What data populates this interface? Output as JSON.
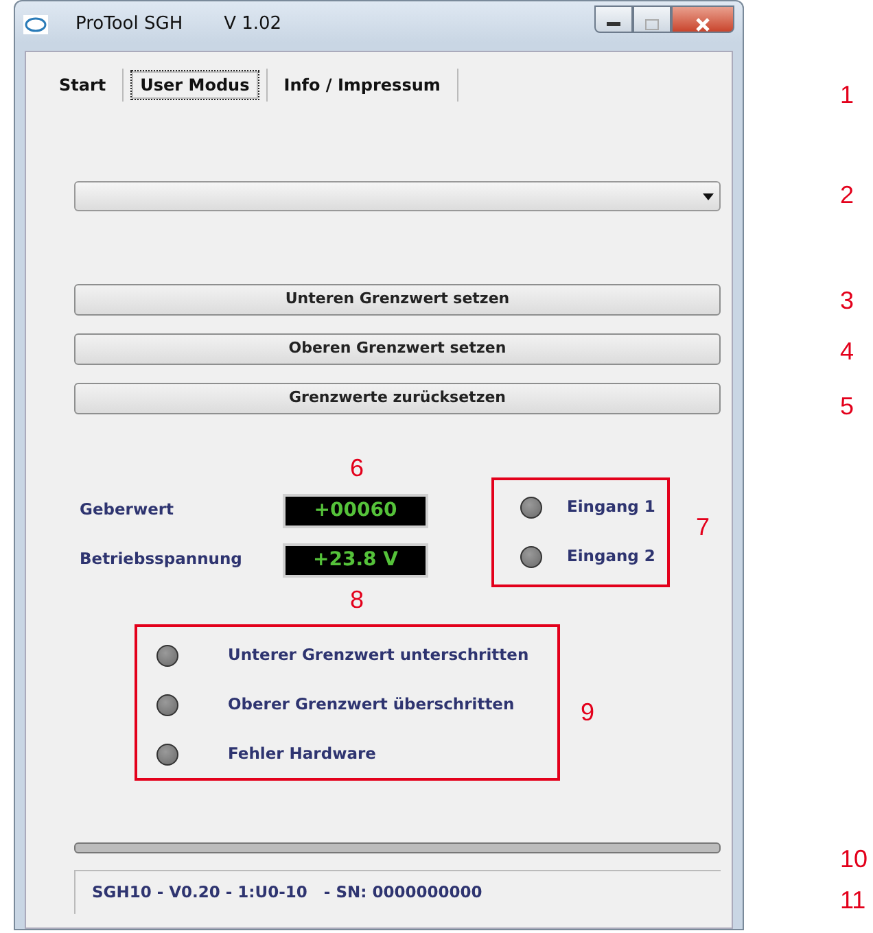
{
  "window": {
    "title": "ProTool SGH",
    "version": "V 1.02"
  },
  "tabs": [
    {
      "label": "Start",
      "selected": false
    },
    {
      "label": "User Modus",
      "selected": true
    },
    {
      "label": "Info / Impressum",
      "selected": false
    }
  ],
  "buttons": [
    "Unteren Grenzwert setzen",
    "Oberen Grenzwert setzen",
    "Grenzwerte zurücksetzen"
  ],
  "readings": [
    {
      "label": "Geberwert",
      "value": "+00060"
    },
    {
      "label": "Betriebsspannung",
      "value": "+23.8 V"
    }
  ],
  "inputs": [
    {
      "label": "Eingang 1",
      "on": false
    },
    {
      "label": "Eingang 2",
      "on": false
    }
  ],
  "alarms": [
    {
      "label": "Unterer Grenzwert unterschritten",
      "on": false
    },
    {
      "label": "Oberer Grenzwert überschritten",
      "on": false
    },
    {
      "label": "Fehler Hardware",
      "on": false
    }
  ],
  "status_bar": "SGH10 - V0.20 - 1:U0-10   - SN: 0000000000",
  "annotations": [
    "1",
    "2",
    "3",
    "4",
    "5",
    "6",
    "7",
    "8",
    "9",
    "10",
    "11"
  ]
}
